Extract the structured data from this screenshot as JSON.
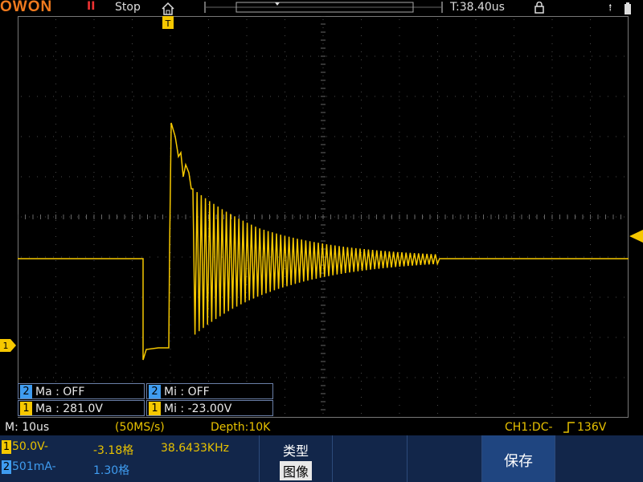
{
  "top": {
    "brand": "OWON",
    "run_icon": "pause-icon",
    "run_state": "Stop",
    "trigger_pos": "T:38.40us",
    "usb_icon": "usb-icon",
    "lock_icon": "lock-icon"
  },
  "colors": {
    "ch1": "#f6c800",
    "ch2": "#3f9cf0",
    "grid": "#4a4a4a",
    "panel": "#12264a"
  },
  "measure": {
    "ch2_max": "Ma : OFF",
    "ch2_min": "Mi : OFF",
    "ch1_max": "Ma : 281.0V",
    "ch1_min": "Mi : -23.00V",
    "ch2_label": "2",
    "ch1_label": "1"
  },
  "info": {
    "timebase": "M: 10us",
    "sample_rate": "(50MS/s)",
    "depth": "Depth:10K",
    "trigger": "CH1:DC-",
    "trigger_level": "136V"
  },
  "status": {
    "ch1_badge": "1",
    "ch1_scale": "50.0V-",
    "ch1_offset": "-3.18格",
    "frequency": "38.6433KHz",
    "ch2_badge": "2",
    "ch2_scale": "501mA-",
    "ch2_offset": "1.30格"
  },
  "menu": {
    "type_label": "类型",
    "type_value": "图像",
    "save_label": "保存"
  },
  "markers": {
    "ch1_marker": "1"
  }
}
